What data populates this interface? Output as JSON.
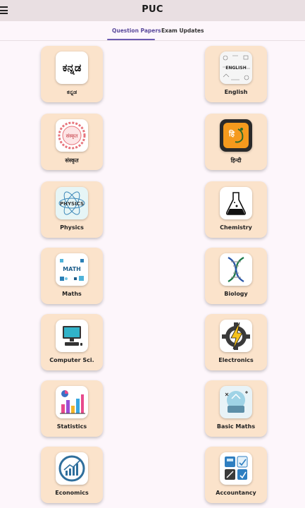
{
  "app": {
    "title": "PUC"
  },
  "tabs": [
    {
      "label": "Question Papers",
      "active": true
    },
    {
      "label": "Exam Updates",
      "active": false
    }
  ],
  "subjects": [
    {
      "label": "ಕನ್ನಡ",
      "icon": "kannada-script-icon"
    },
    {
      "label": "English",
      "icon": "english-doodle-icon"
    },
    {
      "label": "संस्कृत",
      "icon": "sanskrit-mandala-icon"
    },
    {
      "label": "हिन्दी",
      "icon": "hindi-icon"
    },
    {
      "label": "Physics",
      "icon": "physics-icon"
    },
    {
      "label": "Chemistry",
      "icon": "flask-icon"
    },
    {
      "label": "Maths",
      "icon": "math-icon"
    },
    {
      "label": "Biology",
      "icon": "dna-icon"
    },
    {
      "label": "Computer Sci.",
      "icon": "computer-icon"
    },
    {
      "label": "Electronics",
      "icon": "gear-lightning-icon"
    },
    {
      "label": "Statistics",
      "icon": "bar-chart-icon"
    },
    {
      "label": "Basic Maths",
      "icon": "math-board-icon"
    },
    {
      "label": "Economics",
      "icon": "growth-chart-icon"
    },
    {
      "label": "Accountancy",
      "icon": "calculator-icon"
    }
  ],
  "icon_text": {
    "kannada": "ಕನ್ನಡ",
    "english": "ENGLISH",
    "sanskrit": "संस्कृत",
    "hindi": "हि",
    "physics": "PHYSICS",
    "math": "MATH"
  }
}
